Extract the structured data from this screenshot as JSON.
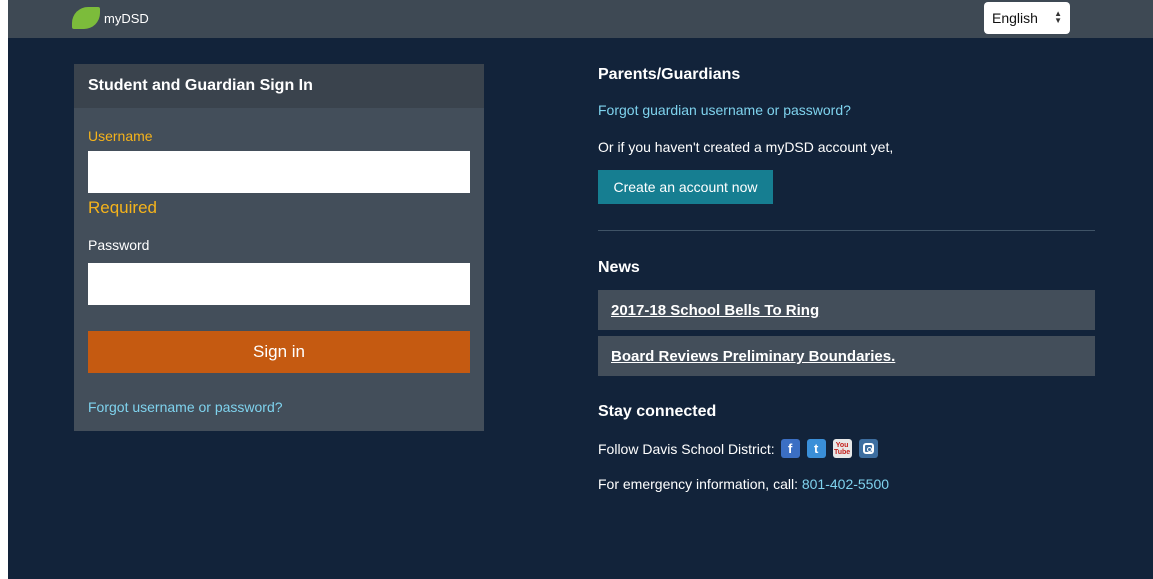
{
  "header": {
    "logo_text": "myDSD",
    "language": "English"
  },
  "signin": {
    "title": "Student and Guardian Sign In",
    "username_label": "Username",
    "username_value": "",
    "required_text": "Required",
    "password_label": "Password",
    "password_value": "",
    "signin_button": "Sign in",
    "forgot_link": "Forgot username or password?"
  },
  "parents": {
    "title": "Parents/Guardians",
    "forgot_link": "Forgot guardian username or password?",
    "no_account_text": "Or if you haven't created a myDSD account yet,",
    "create_button": "Create an account now"
  },
  "news": {
    "title": "News",
    "items": [
      "2017-18 School Bells To Ring",
      "Board Reviews Preliminary Boundaries."
    ]
  },
  "stay_connected": {
    "title": "Stay connected",
    "follow_text": "Follow Davis School District:",
    "social_icons": [
      "facebook-icon",
      "twitter-icon",
      "youtube-icon",
      "instagram-icon"
    ],
    "emergency_text": "For emergency information, call:",
    "phone": "801-402-5500"
  },
  "colors": {
    "background": "#12233a",
    "panel": "#434e5a",
    "accent_orange": "#c55a11",
    "accent_teal": "#167e91",
    "link": "#7fd3ee",
    "warning": "#f5b31b"
  }
}
